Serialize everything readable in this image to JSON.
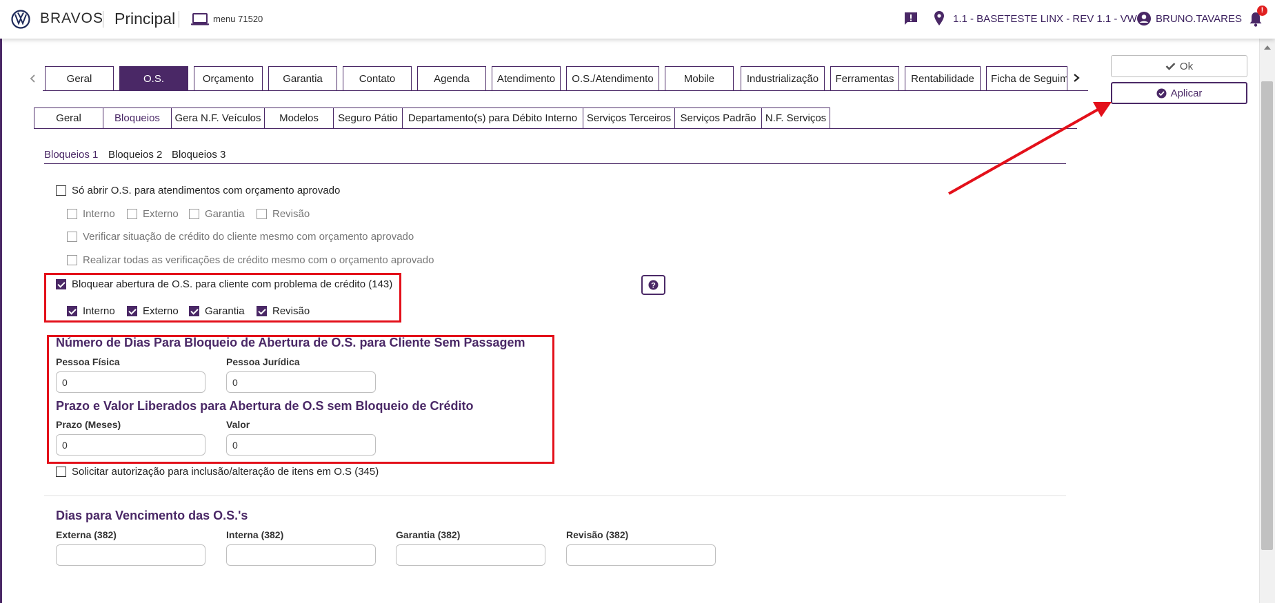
{
  "topbar": {
    "brand": "BRAVOS",
    "module": "Principal",
    "menu_code": "menu 71520",
    "branch": "1.1 - BASETESTE LINX - REV 1.1 - VW",
    "user": "BRUNO.TAVARES",
    "notification_badge": "!"
  },
  "tabs_main": [
    {
      "label": "Geral",
      "active": false
    },
    {
      "label": "O.S.",
      "active": true
    },
    {
      "label": "Orçamento",
      "active": false
    },
    {
      "label": "Garantia",
      "active": false
    },
    {
      "label": "Contato",
      "active": false
    },
    {
      "label": "Agenda",
      "active": false
    },
    {
      "label": "Atendimento",
      "active": false
    },
    {
      "label": "O.S./Atendimento",
      "active": false
    },
    {
      "label": "Mobile",
      "active": false
    },
    {
      "label": "Industrialização",
      "active": false
    },
    {
      "label": "Ferramentas",
      "active": false
    },
    {
      "label": "Rentabilidade",
      "active": false
    },
    {
      "label": "Ficha de Seguim",
      "active": false
    }
  ],
  "tabs_sub": [
    {
      "label": "Geral",
      "active": false
    },
    {
      "label": "Bloqueios",
      "active": true
    },
    {
      "label": "Gera N.F. Veículos",
      "active": false
    },
    {
      "label": "Modelos",
      "active": false
    },
    {
      "label": "Seguro Pátio",
      "active": false
    },
    {
      "label": "Departamento(s) para Débito Interno",
      "active": false
    },
    {
      "label": "Serviços Terceiros",
      "active": false
    },
    {
      "label": "Serviços Padrão",
      "active": false
    },
    {
      "label": "N.F. Serviços",
      "active": false
    }
  ],
  "subtabs": [
    {
      "label": "Bloqueios 1",
      "active": true
    },
    {
      "label": "Bloqueios 2",
      "active": false
    },
    {
      "label": "Bloqueios 3",
      "active": false
    }
  ],
  "buttons": {
    "ok": "Ok",
    "apply": "Aplicar"
  },
  "checks": {
    "orcamento_aprovado": {
      "label": "Só abrir O.S. para atendimentos com orçamento aprovado",
      "checked": false
    },
    "orc_types": [
      {
        "label": "Interno",
        "checked": false
      },
      {
        "label": "Externo",
        "checked": false
      },
      {
        "label": "Garantia",
        "checked": false
      },
      {
        "label": "Revisão",
        "checked": false
      }
    ],
    "verificar_credito": {
      "label": "Verificar situação de crédito do cliente mesmo com orçamento aprovado",
      "checked": false
    },
    "realizar_verificacoes": {
      "label": "Realizar todas as verificações de crédito mesmo com o orçamento aprovado",
      "checked": false
    },
    "bloquear_credito": {
      "label": "Bloquear abertura de O.S. para cliente com problema de crédito (143)",
      "checked": true
    },
    "credito_types": [
      {
        "label": "Interno",
        "checked": true
      },
      {
        "label": "Externo",
        "checked": true
      },
      {
        "label": "Garantia",
        "checked": true
      },
      {
        "label": "Revisão",
        "checked": true
      }
    ],
    "solicitar_autorizacao": {
      "label": "Solicitar autorização para inclusão/alteração de itens em O.S (345)",
      "checked": false
    }
  },
  "section_dias_bloqueio": {
    "title": "Número de Dias Para Bloqueio de Abertura de O.S. para Cliente Sem Passagem",
    "pessoa_fisica_label": "Pessoa Física",
    "pessoa_fisica_value": "0",
    "pessoa_juridica_label": "Pessoa Jurídica",
    "pessoa_juridica_value": "0"
  },
  "section_prazo_valor": {
    "title": "Prazo e Valor Liberados para Abertura de O.S sem Bloqueio de Crédito",
    "prazo_label": "Prazo (Meses)",
    "prazo_value": "0",
    "valor_label": "Valor",
    "valor_value": "0"
  },
  "section_vencimento": {
    "title": "Dias para Vencimento das O.S.'s",
    "externa_label": "Externa (382)",
    "interna_label": "Interna (382)",
    "garantia_label": "Garantia (382)",
    "revisao_label": "Revisão (382)"
  },
  "colors": {
    "accent": "#4a2866",
    "annotation": "#e3101a"
  }
}
